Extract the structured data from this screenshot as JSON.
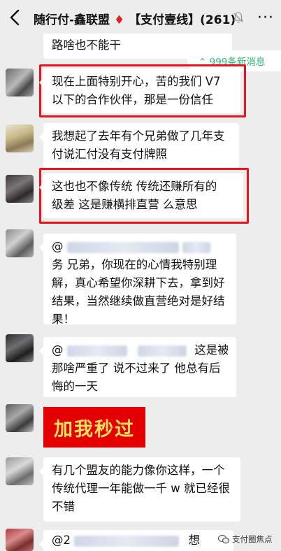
{
  "header": {
    "title_prefix": "随行付-鑫联盟",
    "diamond": "♦",
    "title_suffix": "【支付壹线】(261)",
    "more": "···"
  },
  "unread_notice": "⌃ 999条新消息",
  "messages": [
    {
      "text": "路啥也不能干"
    },
    {
      "text_lines": [
        "现在上面特别开心，苦的我们 V7",
        "以下的合作伙伴，那是一份信任"
      ],
      "highlighted": true
    },
    {
      "text_lines": [
        "我想起了去年有个兄弟做了几年支",
        "付说汇付没有支付牌照"
      ]
    },
    {
      "text_lines": [
        "这也也不像传统  传统还赚所有的",
        "级差 这是赚横排直营 么意思"
      ],
      "highlighted": true
    },
    {
      "mention": "@",
      "text_lines": [
        "务  兄弟，你现在的心情我特别理",
        "解，真心希望你深耕下去，拿到好",
        "结果，当然继续做直营绝对是好结",
        "果！"
      ]
    },
    {
      "mention": "@",
      "first_line_tail": "这是被",
      "text_lines": [
        "那啥严重了 说不过来了 他总有后",
        "悔的一天"
      ]
    },
    {
      "ad_text": "加我秒过"
    },
    {
      "text_lines": [
        "有几个盟友的能力像你这样，一个",
        "传统代理一年能做一千 w 就已经很",
        "不错"
      ]
    },
    {
      "mention": "@2",
      "tail": "想"
    }
  ],
  "watermark": "支付圈焦点"
}
